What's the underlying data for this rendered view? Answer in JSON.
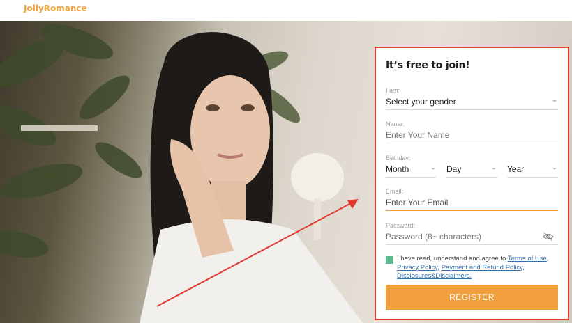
{
  "header": {
    "logo": "JollyRomance"
  },
  "form": {
    "title": "It’s free to join!",
    "gender": {
      "label": "I am:",
      "value": "Select your gender"
    },
    "name": {
      "label": "Name:",
      "placeholder": "Enter Your Name"
    },
    "birthday": {
      "label": "Birthday:",
      "month": "Month",
      "day": "Day",
      "year": "Year"
    },
    "email": {
      "label": "Email:",
      "placeholder": "Enter Your Email"
    },
    "password": {
      "label": "Password:",
      "placeholder": "Password (8+ characters)"
    },
    "terms": {
      "prefix": "I have read, understand and agree to ",
      "terms_of_use": "Terms of Use",
      "privacy": "Privacy Policy",
      "payment": "Payment and Refund Policy",
      "disclosures": "Disclosures&Disclaimers."
    },
    "register_label": "REGISTER"
  },
  "colors": {
    "brand": "#f0a43c",
    "button": "#f2a03d",
    "highlight_border": "#e03a2f",
    "arrow": "#e03a2f",
    "checkbox": "#5cb88d",
    "link": "#2f6fb3"
  },
  "icons": {
    "password_visibility": "eye-slash-icon",
    "checkbox": "checkbox-checked-icon"
  }
}
